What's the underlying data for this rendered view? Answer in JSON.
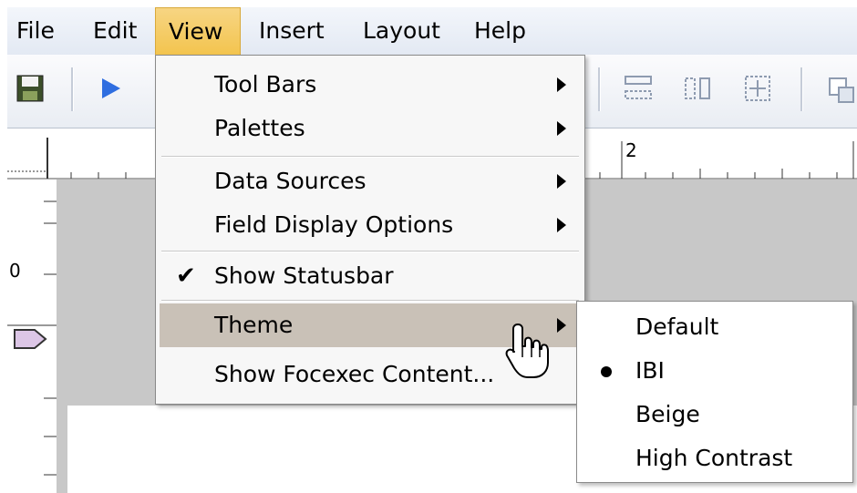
{
  "menubar": {
    "items": [
      {
        "label": "File"
      },
      {
        "label": "Edit"
      },
      {
        "label": "View"
      },
      {
        "label": "Insert"
      },
      {
        "label": "Layout"
      },
      {
        "label": "Help"
      }
    ],
    "active": "View"
  },
  "toolbar": {
    "icons": [
      "save-icon",
      "run-icon",
      "align-top-icon",
      "align-center-icon",
      "distribute-icon",
      "bring-front-icon"
    ]
  },
  "ruler": {
    "marks": [
      "2",
      "0"
    ]
  },
  "view_menu": {
    "items": [
      {
        "label": "Tool Bars",
        "submenu": true
      },
      {
        "label": "Palettes",
        "submenu": true
      },
      {
        "label": "Data Sources",
        "submenu": true
      },
      {
        "label": "Field Display Options",
        "submenu": true
      },
      {
        "label": "Show Statusbar",
        "checked": true
      },
      {
        "label": "Theme",
        "submenu": true,
        "highlighted": true
      },
      {
        "label": "Show Focexec Content..."
      }
    ]
  },
  "theme_submenu": {
    "items": [
      {
        "label": "Default"
      },
      {
        "label": "IBI",
        "selected": true
      },
      {
        "label": "Beige"
      },
      {
        "label": "High Contrast"
      }
    ]
  },
  "colors": {
    "menu_active": "#f3c44e",
    "highlight": "#c9c1b7",
    "canvas_gray": "#c8c8c8"
  }
}
